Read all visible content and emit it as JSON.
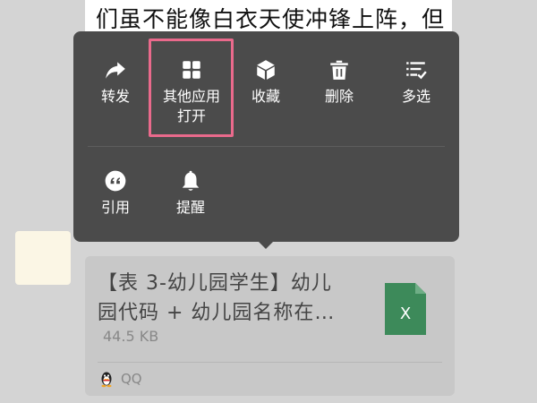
{
  "message": {
    "text": "们虽不能像白衣天使冲锋上阵，但"
  },
  "menu": {
    "items": [
      {
        "label": "转发",
        "icon": "forward-icon"
      },
      {
        "label": "其他应用\n打开",
        "icon": "grid-apps-icon"
      },
      {
        "label": "收藏",
        "icon": "cube-favorite-icon"
      },
      {
        "label": "删除",
        "icon": "trash-icon"
      },
      {
        "label": "多选",
        "icon": "multi-select-icon"
      },
      {
        "label": "引用",
        "icon": "quote-icon"
      },
      {
        "label": "提醒",
        "icon": "bell-icon"
      }
    ],
    "highlight_color": "#ea6a8c"
  },
  "file": {
    "name": "【表 3-幼儿园学生】幼儿园代码 + 幼儿园名称在…",
    "size": "44.5 KB",
    "type_letter": "X",
    "type_color": "#3d8a5a",
    "source": "QQ"
  }
}
